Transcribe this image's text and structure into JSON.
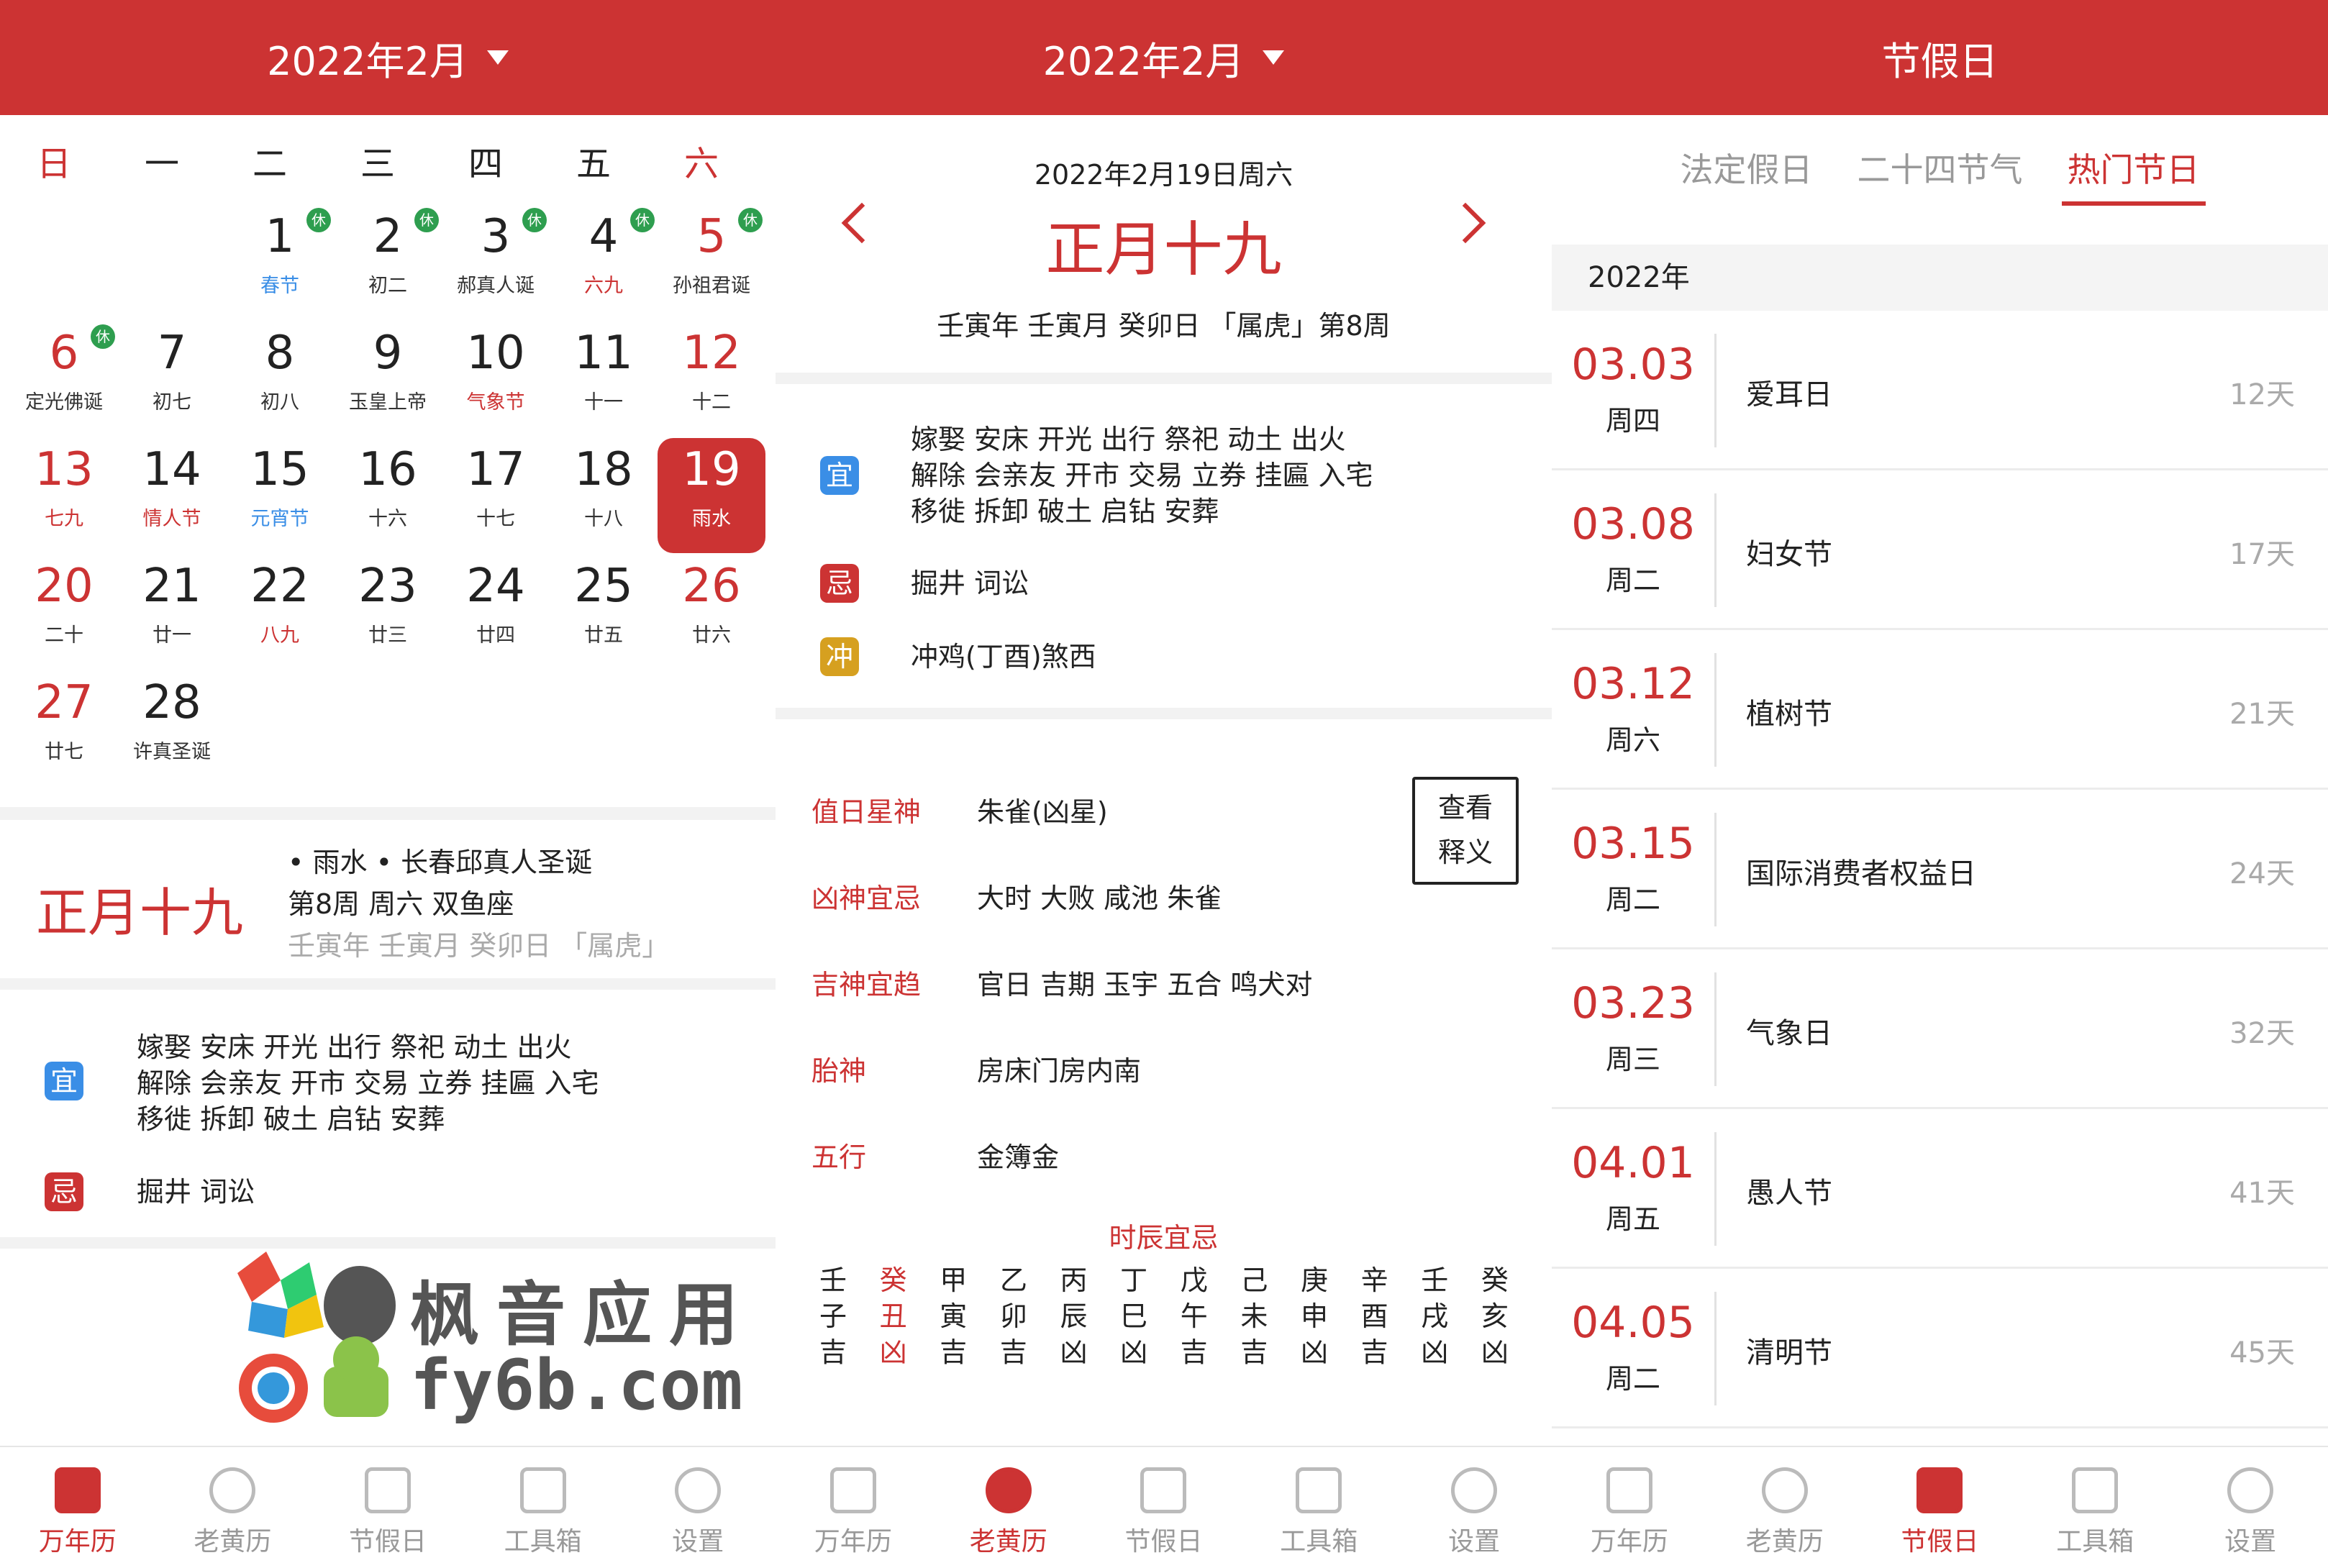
{
  "screens": {
    "calendar": {
      "title": "2022年2月",
      "weekdays": [
        "日",
        "一",
        "二",
        "三",
        "四",
        "五",
        "六"
      ],
      "days": [
        {
          "d": "1",
          "l": "春节",
          "hol": "休",
          "lc": "blue"
        },
        {
          "d": "2",
          "l": "初二",
          "hol": "休"
        },
        {
          "d": "3",
          "l": "郝真人诞",
          "hol": "休"
        },
        {
          "d": "4",
          "l": "六九",
          "hol": "休",
          "lc": "red"
        },
        {
          "d": "5",
          "l": "孙祖君诞",
          "hol": "休"
        },
        {
          "d": "6",
          "l": "定光佛诞",
          "hol": "休"
        },
        {
          "d": "7",
          "l": "初七"
        },
        {
          "d": "8",
          "l": "初八"
        },
        {
          "d": "9",
          "l": "玉皇上帝"
        },
        {
          "d": "10",
          "l": "气象节",
          "lc": "red"
        },
        {
          "d": "11",
          "l": "十一"
        },
        {
          "d": "12",
          "l": "十二"
        },
        {
          "d": "13",
          "l": "七九",
          "lc": "red"
        },
        {
          "d": "14",
          "l": "情人节",
          "lc": "red"
        },
        {
          "d": "15",
          "l": "元宵节",
          "lc": "blue"
        },
        {
          "d": "16",
          "l": "十六"
        },
        {
          "d": "17",
          "l": "十七"
        },
        {
          "d": "18",
          "l": "十八"
        },
        {
          "d": "19",
          "l": "雨水"
        },
        {
          "d": "20",
          "l": "二十"
        },
        {
          "d": "21",
          "l": "廿一"
        },
        {
          "d": "22",
          "l": "八九",
          "lc": "red"
        },
        {
          "d": "23",
          "l": "廿三"
        },
        {
          "d": "24",
          "l": "廿四"
        },
        {
          "d": "25",
          "l": "廿五"
        },
        {
          "d": "26",
          "l": "廿六"
        },
        {
          "d": "27",
          "l": "廿七"
        },
        {
          "d": "28",
          "l": "许真圣诞"
        }
      ],
      "today": {
        "big": "正月十九",
        "line1": "• 雨水  • 长春邱真人圣诞",
        "line2": "第8周 周六 双鱼座",
        "line3": "壬寅年 壬寅月 癸卯日 「属虎」"
      },
      "yi_label": "宜",
      "yi_lines": [
        "嫁娶 安床 开光 出行 祭祀 动土 出火",
        "解除 会亲友 开市 交易 立券 挂匾 入宅",
        "移徙 拆卸 破土 启钻 安葬"
      ],
      "ji_label": "忌",
      "ji_text": "掘井 词讼"
    },
    "almanac": {
      "title": "2022年2月",
      "date": "2022年2月19日周六",
      "lunar": "正月十九",
      "ganzhi": "壬寅年 壬寅月 癸卯日 「属虎」第8周",
      "yi_label": "宜",
      "yi_lines": [
        "嫁娶 安床 开光 出行 祭祀 动土 出火",
        "解除 会亲友 开市 交易 立券 挂匾 入宅",
        "移徙 拆卸 破土 启钻 安葬"
      ],
      "ji_label": "忌",
      "ji_text": "掘井 词讼",
      "chong_label": "冲",
      "chong_text": "冲鸡(丁酉)煞西",
      "rows": [
        {
          "k": "值日星神",
          "v": "朱雀(凶星)"
        },
        {
          "k": "凶神宜忌",
          "v": "大时 大败 咸池 朱雀"
        },
        {
          "k": "吉神宜趋",
          "v": "官日 吉期 玉宇 五合 鸣犬对"
        },
        {
          "k": "胎神",
          "v": "房床门房内南"
        },
        {
          "k": "五行",
          "v": "金簿金"
        }
      ],
      "explain": [
        "查看",
        "释义"
      ],
      "shichen_title": "时辰宜忌",
      "shichen": [
        {
          "a": "壬",
          "b": "子",
          "c": "吉"
        },
        {
          "a": "癸",
          "b": "丑",
          "c": "凶",
          "hl": true
        },
        {
          "a": "甲",
          "b": "寅",
          "c": "吉"
        },
        {
          "a": "乙",
          "b": "卯",
          "c": "吉"
        },
        {
          "a": "丙",
          "b": "辰",
          "c": "凶"
        },
        {
          "a": "丁",
          "b": "巳",
          "c": "凶"
        },
        {
          "a": "戊",
          "b": "午",
          "c": "吉"
        },
        {
          "a": "己",
          "b": "未",
          "c": "吉"
        },
        {
          "a": "庚",
          "b": "申",
          "c": "凶"
        },
        {
          "a": "辛",
          "b": "酉",
          "c": "吉"
        },
        {
          "a": "壬",
          "b": "戌",
          "c": "凶"
        },
        {
          "a": "癸",
          "b": "亥",
          "c": "凶"
        }
      ]
    },
    "holidays": {
      "title": "节假日",
      "tabs": [
        "法定假日",
        "二十四节气",
        "热门节日"
      ],
      "active_tab": "热门节日",
      "year": "2022年",
      "items": [
        {
          "date": "03.03",
          "week": "周四",
          "name": "爱耳日",
          "days": "12天"
        },
        {
          "date": "03.08",
          "week": "周二",
          "name": "妇女节",
          "days": "17天"
        },
        {
          "date": "03.12",
          "week": "周六",
          "name": "植树节",
          "days": "21天"
        },
        {
          "date": "03.15",
          "week": "周二",
          "name": "国际消费者权益日",
          "days": "24天"
        },
        {
          "date": "03.23",
          "week": "周三",
          "name": "气象日",
          "days": "32天"
        },
        {
          "date": "04.01",
          "week": "周五",
          "name": "愚人节",
          "days": "41天"
        },
        {
          "date": "04.05",
          "week": "周二",
          "name": "清明节",
          "days": "45天"
        }
      ]
    }
  },
  "nav": [
    {
      "label": "万年历",
      "icon": "calendar-icon"
    },
    {
      "label": "老黄历",
      "icon": "yinyang-icon"
    },
    {
      "label": "节假日",
      "icon": "holiday-check-icon"
    },
    {
      "label": "工具箱",
      "icon": "grid-icon"
    },
    {
      "label": "设置",
      "icon": "gear-icon"
    }
  ],
  "watermark": {
    "line1": "枫音应用",
    "line2": "fy6b.com"
  },
  "colors": {
    "primary": "#cc3333",
    "blue": "#3a8ee6",
    "green": "#2e9e4f",
    "gold": "#d6a020"
  }
}
